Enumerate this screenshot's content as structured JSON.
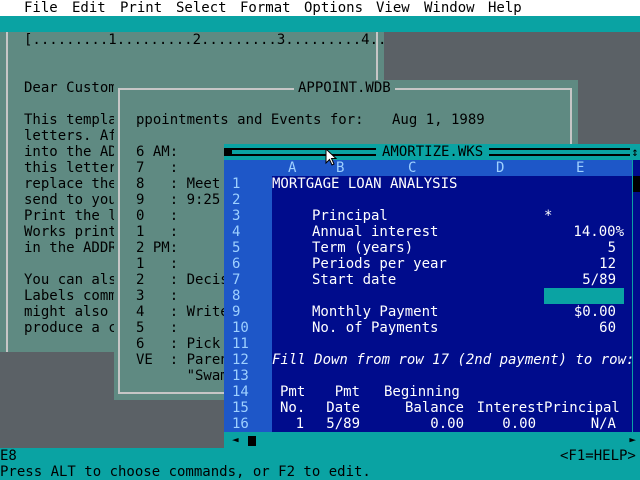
{
  "menu": [
    "File",
    "Edit",
    "Print",
    "Select",
    "Format",
    "Options",
    "View",
    "Window",
    "Help"
  ],
  "doc": {
    "ruler": "[.........1.........2.........3.........4..",
    "lines": [
      "Dear Custom",
      "",
      "This templa",
      "letters. Af",
      "into the AD",
      "this letter",
      "replace the",
      "send to you",
      "Print the l",
      "Works print",
      "in the ADDR",
      "",
      "You can als",
      "Labels comm",
      "might also ",
      "produce a c"
    ]
  },
  "db": {
    "title": "APPOINT.WDB",
    "heading": "ppointments and Events for:",
    "date": "Aug 1, 1989",
    "rows": [
      "6 AM:",
      "7   :",
      "8   : Meet",
      "9   : 9:25",
      "0   :",
      "1   :",
      "2 PM:",
      "1   :",
      "2   : Decis",
      "3   :",
      "4   : Write",
      "5   :",
      "6   : Pick",
      "VE  : Paren",
      "      \"Swam"
    ]
  },
  "sheet": {
    "title": "AMORTIZE.WKS",
    "columns": [
      "A",
      "B",
      "C",
      "D",
      "E"
    ],
    "row_numbers": [
      "1",
      "2",
      "3",
      "4",
      "5",
      "6",
      "7",
      "8",
      "9",
      "10",
      "11",
      "12",
      "13",
      "14",
      "15",
      "16"
    ],
    "cells": {
      "r1": "MORTGAGE LOAN ANALYSIS",
      "r3_label": "Principal",
      "r3_value": "*",
      "r4_label": "Annual interest",
      "r4_value": "14.00%",
      "r5_label": "Term (years)",
      "r5_value": "5",
      "r6_label": "Periods per year",
      "r6_value": "12",
      "r7_label": "Start date",
      "r7_value": "5/89",
      "r9_label": "Monthly Payment",
      "r9_value": "$0.00",
      "r10_label": "No. of Payments",
      "r10_value": "60",
      "r12": "Fill Down from row 17 (2nd payment) to row:",
      "h14_a": "Pmt",
      "h14_b": "Pmt",
      "h14_c": "Beginning",
      "h15_a": "No.",
      "h15_b": "Date",
      "h15_c": "Balance",
      "h15_d": "Interest",
      "h15_e": "Principal",
      "r16_a": "1",
      "r16_b": "5/89",
      "r16_c": "0.00",
      "r16_d": "0.00",
      "r16_e": "N/A"
    }
  },
  "status": {
    "cell_ref": "E8",
    "help_key": "<F1=HELP>",
    "prompt": "Press ALT to choose commands, or F2 to edit."
  }
}
